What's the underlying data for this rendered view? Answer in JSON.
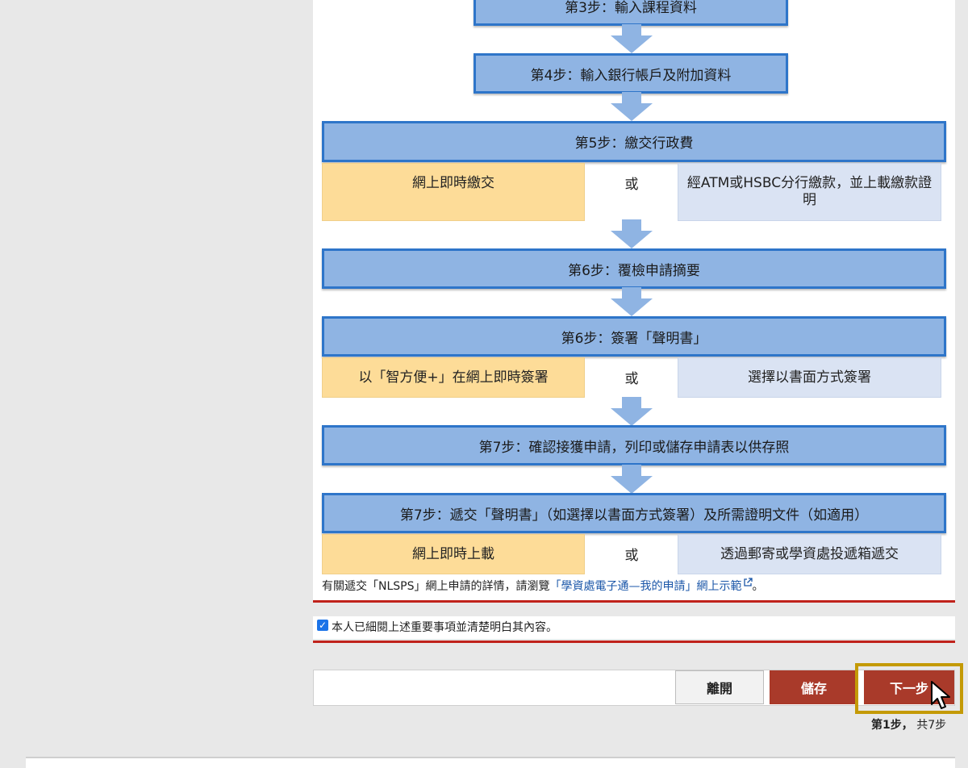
{
  "flow": {
    "step3": "第3步：輸入課程資料",
    "step4": "第4步：輸入銀行帳戶及附加資料",
    "step5": "第5步：繳交行政費",
    "step5_left": "網上即時繳交",
    "step5_or": "或",
    "step5_right": "經ATM或HSBC分行繳款，並上載繳款證明",
    "step6a": "第6步：覆檢申請摘要",
    "step6b": "第6步：簽署「聲明書」",
    "step6b_left": "以「智方便+」在網上即時簽署",
    "step6b_or": "或",
    "step6b_right": "選擇以書面方式簽署",
    "step7a": "第7步：確認接獲申請，列印或儲存申請表以供存照",
    "step7b": "第7步：遞交「聲明書」（如選擇以書面方式簽署）及所需證明文件（如適用）",
    "step7b_left": "網上即時上載",
    "step7b_or": "或",
    "step7b_right": "透過郵寄或學資處投遞箱遞交"
  },
  "note": {
    "prefix": "有關遞交「NLSPS」網上申請的詳情，請瀏覽",
    "link": "「學資處電子通—我的申請」網上示範",
    "suffix": "。"
  },
  "confirm": {
    "checked": true,
    "label": "本人已細閱上述重要事項並清楚明白其內容。"
  },
  "actions": {
    "leave": "離開",
    "save": "儲存",
    "next": "下一步"
  },
  "progress": {
    "current": "第1步，",
    "total": "共7步"
  },
  "colors": {
    "step_fill": "#8fb4e3",
    "step_border": "#2e75c9",
    "option_left": "#fddc98",
    "option_right": "#dae3f3",
    "accent_red": "#a93a2a",
    "highlight": "#c49a06"
  }
}
